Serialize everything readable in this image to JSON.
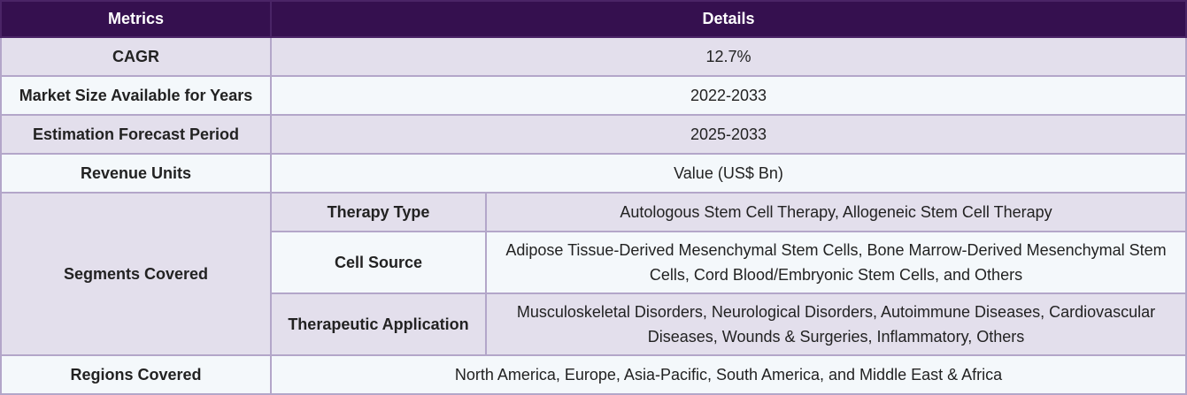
{
  "table": {
    "headers": [
      "Metrics",
      "Details"
    ],
    "rows": {
      "cagr": {
        "label": "CAGR",
        "value": "12.7%"
      },
      "market_size": {
        "label": "Market Size Available for Years",
        "value": "2022-2033"
      },
      "forecast": {
        "label": "Estimation Forecast Period",
        "value": "2025-2033"
      },
      "revenue": {
        "label": "Revenue Units",
        "value": "Value (US$ Bn)"
      },
      "segments": {
        "label": "Segments Covered",
        "items": [
          {
            "label": "Therapy Type",
            "value": "Autologous Stem Cell Therapy, Allogeneic Stem Cell Therapy"
          },
          {
            "label": "Cell Source",
            "value": "Adipose Tissue-Derived Mesenchymal Stem Cells, Bone Marrow-Derived Mesenchymal Stem Cells, Cord Blood/Embryonic Stem Cells, and Others"
          },
          {
            "label": "Therapeutic Application",
            "value": "Musculoskeletal Disorders, Neurological Disorders, Autoimmune Diseases, Cardiovascular Diseases, Wounds & Surgeries, Inflammatory, Others"
          }
        ]
      },
      "regions": {
        "label": "Regions Covered",
        "value": "North America, Europe, Asia-Pacific, South America, and Middle East & Africa"
      }
    }
  },
  "colors": {
    "header_bg": "#35104f",
    "row_alt": "#e3dfec",
    "row_plain": "#f4f8fb",
    "border": "#b3a6c9"
  }
}
